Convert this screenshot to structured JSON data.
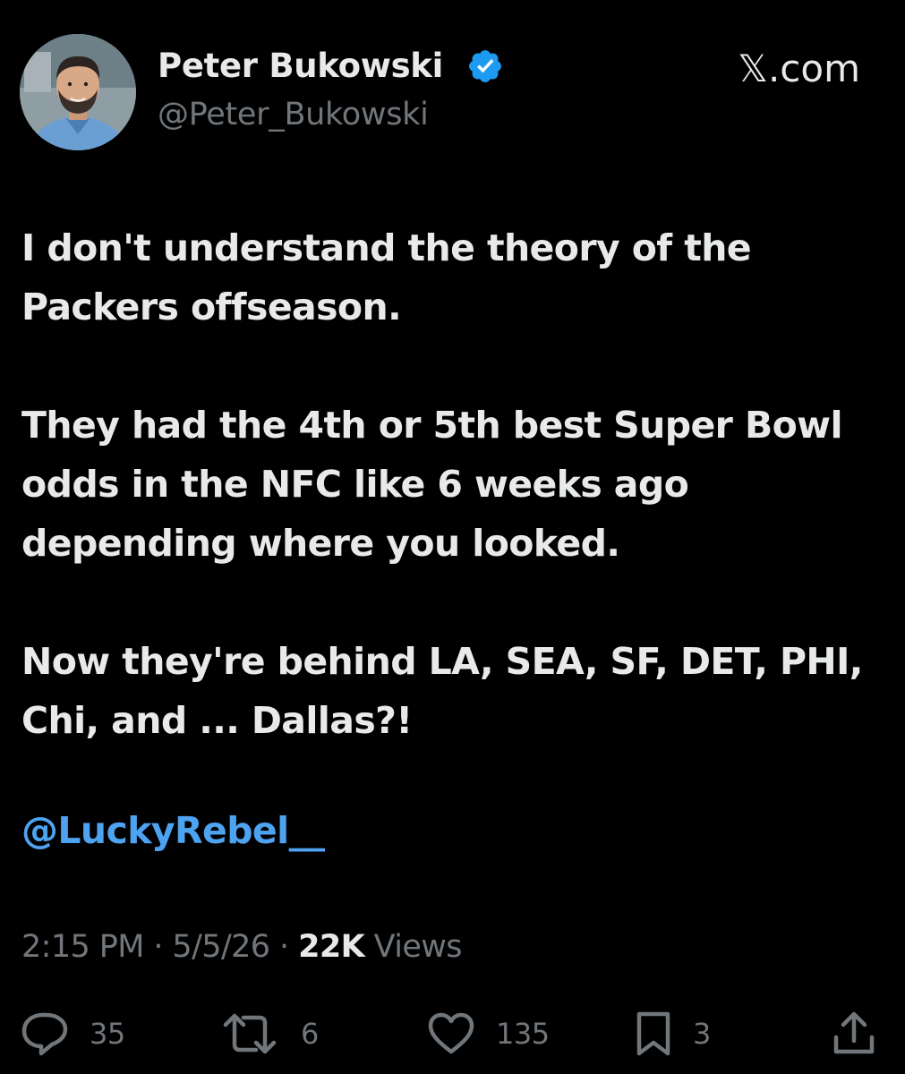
{
  "author": {
    "display_name": "Peter Bukowski",
    "handle": "@Peter_Bukowski",
    "verified": true,
    "verified_color": "#1d9bf0",
    "avatar_icon": "profile-photo"
  },
  "brand": {
    "label": "𝕏.com"
  },
  "post": {
    "paragraphs": [
      "I don't understand the theory of the Packers offseason.",
      "They had the 4th or 5th best Super Bowl odds in the NFC like 6 weeks ago depending where you looked.",
      "Now they're behind LA, SEA, SF, DET, PHI, Chi, and ... Dallas?!"
    ],
    "mention": "@LuckyRebel__",
    "mention_color": "#4ea3f0"
  },
  "meta": {
    "time": "2:15 PM",
    "date": "5/5/26",
    "separator": "·",
    "views_count": "22K",
    "views_label": "Views"
  },
  "actions": {
    "reply": {
      "icon": "reply-icon",
      "count": "35"
    },
    "retweet": {
      "icon": "retweet-icon",
      "count": "6"
    },
    "like": {
      "icon": "heart-icon",
      "count": "135"
    },
    "bookmark": {
      "icon": "bookmark-icon",
      "count": "3"
    },
    "share": {
      "icon": "share-icon"
    }
  },
  "colors": {
    "background": "#000000",
    "text_primary": "#e7e9ea",
    "text_secondary": "#71767b"
  }
}
